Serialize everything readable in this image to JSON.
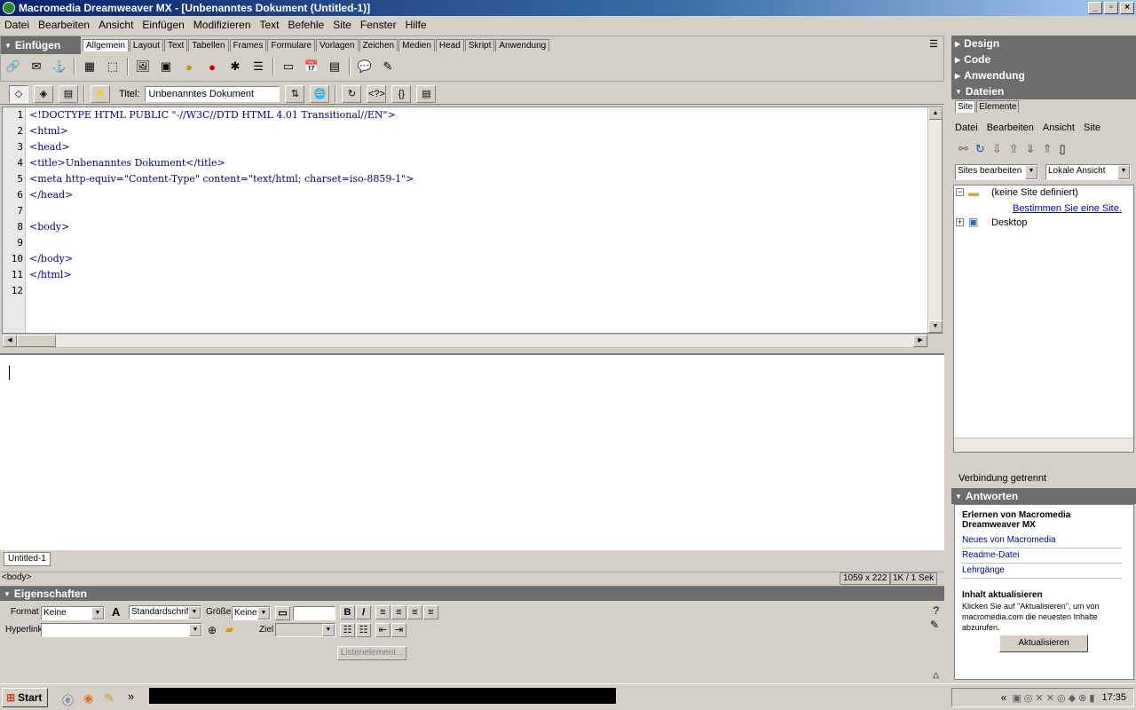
{
  "window": {
    "title": "Macromedia Dreamweaver MX - [Unbenanntes Dokument (Untitled-1)]"
  },
  "menu": [
    "Datei",
    "Bearbeiten",
    "Ansicht",
    "Einfügen",
    "Modifizieren",
    "Text",
    "Befehle",
    "Site",
    "Fenster",
    "Hilfe"
  ],
  "insert_panel": {
    "title": "Einfügen",
    "tabs": [
      "Allgemein",
      "Layout",
      "Text",
      "Tabellen",
      "Frames",
      "Formulare",
      "Vorlagen",
      "Zeichen",
      "Medien",
      "Head",
      "Skript",
      "Anwendung"
    ],
    "selected_tab": "Allgemein"
  },
  "doc_toolbar": {
    "title_label": "Titel:",
    "title_value": "Unbenanntes Dokument"
  },
  "code": {
    "line_numbers": [
      "1",
      "2",
      "3",
      "4",
      "5",
      "6",
      "7",
      "8",
      "9",
      "10",
      "11",
      "12"
    ],
    "lines": [
      "<!DOCTYPE HTML PUBLIC \"-//W3C//DTD HTML 4.01 Transitional//EN\">",
      "<html>",
      "<head>",
      "<title>Unbenanntes Dokument</title>",
      "<meta http-equiv=\"Content-Type\" content=\"text/html; charset=iso-8859-1\">",
      "</head>",
      "",
      "<body>",
      "",
      "</body>",
      "</html>",
      ""
    ]
  },
  "document_tab": "Untitled-1",
  "statusbar": {
    "tag": "<body>",
    "size": "1059 x 222",
    "download": "1K / 1 Sek"
  },
  "properties": {
    "title": "Eigenschaften",
    "format_label": "Format",
    "format_value": "Keine",
    "font_value": "Standardschrift",
    "size_label": "Größe",
    "size_value": "Keine",
    "link_label": "Hyperlink",
    "target_label": "Ziel",
    "list_button": "Listenelement..."
  },
  "right_panels": {
    "design": "Design",
    "code": "Code",
    "anwendung": "Anwendung",
    "dateien": "Dateien",
    "files_tabs": [
      "Site",
      "Elemente"
    ],
    "files_menu": [
      "Datei",
      "Bearbeiten",
      "Ansicht",
      "Site"
    ],
    "site_select": "Sites bearbeiten",
    "view_select": "Lokale Ansicht",
    "tree_root": "(keine Site definiert)",
    "tree_link": "Bestimmen Sie eine Site.",
    "tree_desktop": "Desktop",
    "connection": "Verbindung getrennt",
    "answers_title": "Antworten",
    "answers_heading": "Erlernen von Macromedia Dreamweaver MX",
    "answers_links": [
      "Neues von Macromedia",
      "Readme-Datei",
      "Lehrgänge"
    ],
    "update_heading": "Inhalt aktualisieren",
    "update_text": "Klicken Sie auf \"Aktualisieren\", um von macromedia.com die neuesten Inhalte abzurufen.",
    "update_button": "Aktualisieren"
  },
  "taskbar": {
    "start": "Start",
    "clock": "17:35"
  }
}
